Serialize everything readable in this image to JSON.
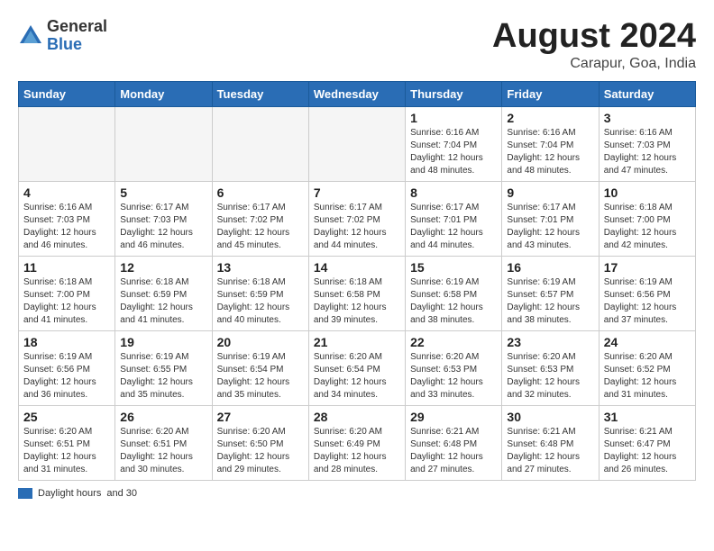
{
  "header": {
    "logo_general": "General",
    "logo_blue": "Blue",
    "month_title": "August 2024",
    "subtitle": "Carapur, Goa, India"
  },
  "days_of_week": [
    "Sunday",
    "Monday",
    "Tuesday",
    "Wednesday",
    "Thursday",
    "Friday",
    "Saturday"
  ],
  "weeks": [
    [
      {
        "num": "",
        "info": ""
      },
      {
        "num": "",
        "info": ""
      },
      {
        "num": "",
        "info": ""
      },
      {
        "num": "",
        "info": ""
      },
      {
        "num": "1",
        "info": "Sunrise: 6:16 AM\nSunset: 7:04 PM\nDaylight: 12 hours\nand 48 minutes."
      },
      {
        "num": "2",
        "info": "Sunrise: 6:16 AM\nSunset: 7:04 PM\nDaylight: 12 hours\nand 48 minutes."
      },
      {
        "num": "3",
        "info": "Sunrise: 6:16 AM\nSunset: 7:03 PM\nDaylight: 12 hours\nand 47 minutes."
      }
    ],
    [
      {
        "num": "4",
        "info": "Sunrise: 6:16 AM\nSunset: 7:03 PM\nDaylight: 12 hours\nand 46 minutes."
      },
      {
        "num": "5",
        "info": "Sunrise: 6:17 AM\nSunset: 7:03 PM\nDaylight: 12 hours\nand 46 minutes."
      },
      {
        "num": "6",
        "info": "Sunrise: 6:17 AM\nSunset: 7:02 PM\nDaylight: 12 hours\nand 45 minutes."
      },
      {
        "num": "7",
        "info": "Sunrise: 6:17 AM\nSunset: 7:02 PM\nDaylight: 12 hours\nand 44 minutes."
      },
      {
        "num": "8",
        "info": "Sunrise: 6:17 AM\nSunset: 7:01 PM\nDaylight: 12 hours\nand 44 minutes."
      },
      {
        "num": "9",
        "info": "Sunrise: 6:17 AM\nSunset: 7:01 PM\nDaylight: 12 hours\nand 43 minutes."
      },
      {
        "num": "10",
        "info": "Sunrise: 6:18 AM\nSunset: 7:00 PM\nDaylight: 12 hours\nand 42 minutes."
      }
    ],
    [
      {
        "num": "11",
        "info": "Sunrise: 6:18 AM\nSunset: 7:00 PM\nDaylight: 12 hours\nand 41 minutes."
      },
      {
        "num": "12",
        "info": "Sunrise: 6:18 AM\nSunset: 6:59 PM\nDaylight: 12 hours\nand 41 minutes."
      },
      {
        "num": "13",
        "info": "Sunrise: 6:18 AM\nSunset: 6:59 PM\nDaylight: 12 hours\nand 40 minutes."
      },
      {
        "num": "14",
        "info": "Sunrise: 6:18 AM\nSunset: 6:58 PM\nDaylight: 12 hours\nand 39 minutes."
      },
      {
        "num": "15",
        "info": "Sunrise: 6:19 AM\nSunset: 6:58 PM\nDaylight: 12 hours\nand 38 minutes."
      },
      {
        "num": "16",
        "info": "Sunrise: 6:19 AM\nSunset: 6:57 PM\nDaylight: 12 hours\nand 38 minutes."
      },
      {
        "num": "17",
        "info": "Sunrise: 6:19 AM\nSunset: 6:56 PM\nDaylight: 12 hours\nand 37 minutes."
      }
    ],
    [
      {
        "num": "18",
        "info": "Sunrise: 6:19 AM\nSunset: 6:56 PM\nDaylight: 12 hours\nand 36 minutes."
      },
      {
        "num": "19",
        "info": "Sunrise: 6:19 AM\nSunset: 6:55 PM\nDaylight: 12 hours\nand 35 minutes."
      },
      {
        "num": "20",
        "info": "Sunrise: 6:19 AM\nSunset: 6:54 PM\nDaylight: 12 hours\nand 35 minutes."
      },
      {
        "num": "21",
        "info": "Sunrise: 6:20 AM\nSunset: 6:54 PM\nDaylight: 12 hours\nand 34 minutes."
      },
      {
        "num": "22",
        "info": "Sunrise: 6:20 AM\nSunset: 6:53 PM\nDaylight: 12 hours\nand 33 minutes."
      },
      {
        "num": "23",
        "info": "Sunrise: 6:20 AM\nSunset: 6:53 PM\nDaylight: 12 hours\nand 32 minutes."
      },
      {
        "num": "24",
        "info": "Sunrise: 6:20 AM\nSunset: 6:52 PM\nDaylight: 12 hours\nand 31 minutes."
      }
    ],
    [
      {
        "num": "25",
        "info": "Sunrise: 6:20 AM\nSunset: 6:51 PM\nDaylight: 12 hours\nand 31 minutes."
      },
      {
        "num": "26",
        "info": "Sunrise: 6:20 AM\nSunset: 6:51 PM\nDaylight: 12 hours\nand 30 minutes."
      },
      {
        "num": "27",
        "info": "Sunrise: 6:20 AM\nSunset: 6:50 PM\nDaylight: 12 hours\nand 29 minutes."
      },
      {
        "num": "28",
        "info": "Sunrise: 6:20 AM\nSunset: 6:49 PM\nDaylight: 12 hours\nand 28 minutes."
      },
      {
        "num": "29",
        "info": "Sunrise: 6:21 AM\nSunset: 6:48 PM\nDaylight: 12 hours\nand 27 minutes."
      },
      {
        "num": "30",
        "info": "Sunrise: 6:21 AM\nSunset: 6:48 PM\nDaylight: 12 hours\nand 27 minutes."
      },
      {
        "num": "31",
        "info": "Sunrise: 6:21 AM\nSunset: 6:47 PM\nDaylight: 12 hours\nand 26 minutes."
      }
    ]
  ],
  "legend": {
    "label": "Daylight hours",
    "sub": "and 30"
  }
}
